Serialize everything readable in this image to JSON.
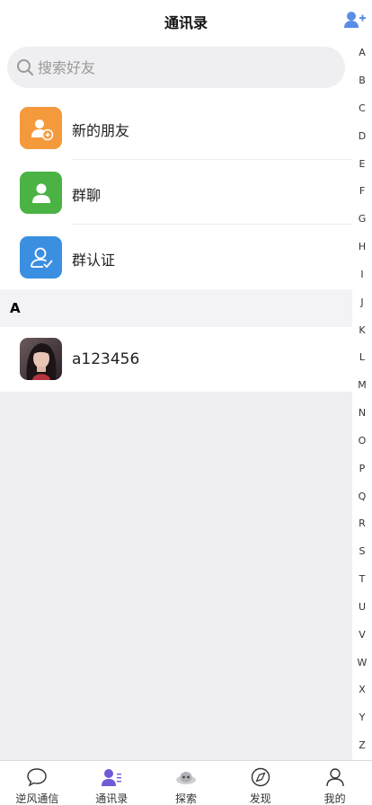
{
  "header": {
    "title": "通讯录",
    "add_icon": "add-friend-icon"
  },
  "search": {
    "placeholder": "搜索好友"
  },
  "menu": [
    {
      "label": "新的朋友",
      "icon": "new-friend-icon",
      "color": "#f59a3c"
    },
    {
      "label": "群聊",
      "icon": "group-chat-icon",
      "color": "#4bb344"
    },
    {
      "label": "群认证",
      "icon": "group-verify-icon",
      "color": "#3b8fe0"
    }
  ],
  "section": {
    "letter": "A"
  },
  "contacts": [
    {
      "name": "a123456",
      "avatar": "profile-photo"
    }
  ],
  "index_letters": [
    "A",
    "B",
    "C",
    "D",
    "E",
    "F",
    "G",
    "H",
    "I",
    "J",
    "K",
    "L",
    "M",
    "N",
    "O",
    "P",
    "Q",
    "R",
    "S",
    "T",
    "U",
    "V",
    "W",
    "X",
    "Y",
    "Z"
  ],
  "tabs": [
    {
      "label": "逆风通信",
      "icon": "chat-bubble-icon"
    },
    {
      "label": "通讯录",
      "icon": "contacts-icon",
      "active": true
    },
    {
      "label": "探索",
      "icon": "explore-icon"
    },
    {
      "label": "发现",
      "icon": "compass-icon"
    },
    {
      "label": "我的",
      "icon": "profile-icon"
    }
  ],
  "colors": {
    "accent": "#5b8de6",
    "active_tab": "#6e5bd6",
    "background": "#efeef0"
  }
}
